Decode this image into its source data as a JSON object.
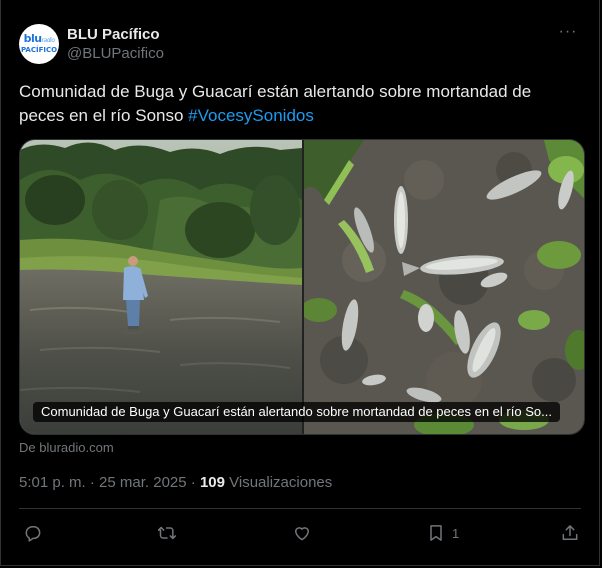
{
  "account": {
    "display_name": "BLU Pacífico",
    "handle": "@BLUPacifico",
    "avatar_logo_top": "blu",
    "avatar_logo_radio": "radio",
    "avatar_logo_bottom": "PACÍFICO"
  },
  "more_menu_label": "···",
  "tweet": {
    "text_main": "Comunidad de Buga y Guacarí están alertando sobre mortandad de peces en el río Sonso ",
    "hashtag": "#VocesySonidos"
  },
  "media": {
    "caption": "Comunidad de Buga y Guacarí están alertando sobre mortandad de peces en el río So...",
    "source": "De bluradio.com",
    "left_image_icon": "man-standing-in-river-photo",
    "right_image_icon": "dead-fish-on-riverbank-photo"
  },
  "meta": {
    "time_date": "5:01 p. m. · 25 mar. 2025 · ",
    "views_count": "109",
    "views_label": " Visualizaciones"
  },
  "actions": {
    "reply_icon": "reply-icon",
    "repost_icon": "repost-icon",
    "like_icon": "like-icon",
    "bookmark_icon": "bookmark-icon",
    "bookmark_count": "1",
    "share_icon": "share-icon"
  },
  "colors": {
    "background": "#000000",
    "text_primary": "#e7e9ea",
    "text_secondary": "#71767b",
    "accent": "#1d9bf0",
    "border": "#2f3336"
  }
}
